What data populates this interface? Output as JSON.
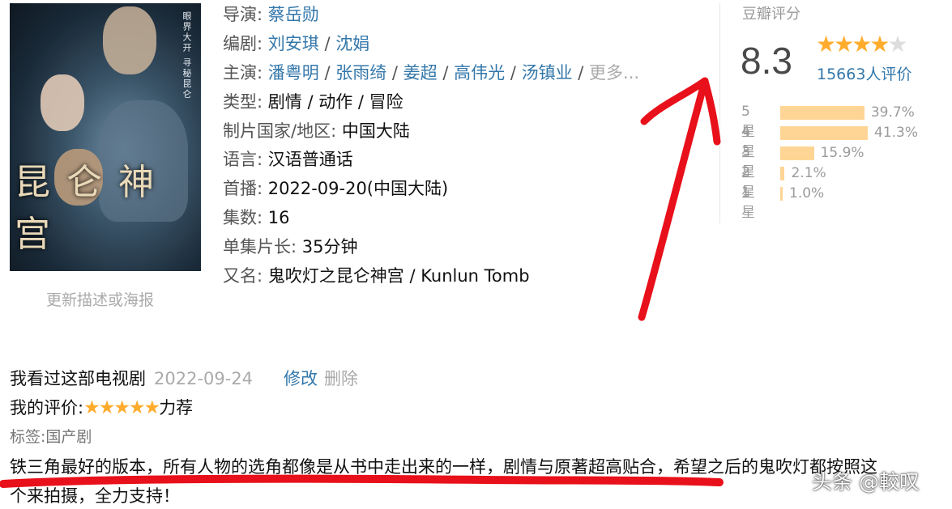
{
  "poster": {
    "title_art": "昆仑神宫",
    "tagline": "眼界大开 寻秘昆仑",
    "update_link": "更新描述或海报"
  },
  "info": {
    "director": {
      "label": "导演:",
      "names": [
        "蔡岳勋"
      ]
    },
    "writer": {
      "label": "编剧:",
      "names": [
        "刘安琪",
        "沈娟"
      ]
    },
    "cast": {
      "label": "主演:",
      "names": [
        "潘粤明",
        "张雨绮",
        "姜超",
        "高伟光",
        "汤镇业"
      ],
      "more": "更多..."
    },
    "genre": {
      "label": "类型:",
      "value": "剧情 / 动作 / 冒险"
    },
    "country": {
      "label": "制片国家/地区:",
      "value": "中国大陆"
    },
    "language": {
      "label": "语言:",
      "value": "汉语普通话"
    },
    "premiere": {
      "label": "首播:",
      "value": "2022-09-20(中国大陆)"
    },
    "episodes": {
      "label": "集数:",
      "value": "16"
    },
    "episode_length": {
      "label": "单集片长:",
      "value": "35分钟"
    },
    "aka": {
      "label": "又名:",
      "value": "鬼吹灯之昆仑神宫 / Kunlun Tomb"
    }
  },
  "rating": {
    "title": "豆瓣评分",
    "score": "8.3",
    "stars_filled": 4,
    "stars_total": 5,
    "votes": "15663人评价",
    "distribution": [
      {
        "label": "5星",
        "percent": 39.7,
        "text": "39.7%"
      },
      {
        "label": "4星",
        "percent": 41.3,
        "text": "41.3%"
      },
      {
        "label": "3星",
        "percent": 15.9,
        "text": "15.9%"
      },
      {
        "label": "2星",
        "percent": 2.1,
        "text": "2.1%"
      },
      {
        "label": "1星",
        "percent": 1.0,
        "text": "1.0%"
      }
    ]
  },
  "my_review": {
    "status": "我看过这部电视剧",
    "date": "2022-09-24",
    "edit": "修改",
    "delete": "删除",
    "rating_label": "我的评价:",
    "stars": 5,
    "rating_text": "力荐",
    "tags": "标签:国产剧",
    "comment_line1": "铁三角最好的版本，所有人物的选角都像是从书中走出来的一样，剧情与原著超高贴合，希望之后的鬼吹灯都按照这",
    "comment_line2": "个来拍摄，全力支持！"
  },
  "watermark": "头条 @較叹",
  "annotation_color": "#e8101a"
}
